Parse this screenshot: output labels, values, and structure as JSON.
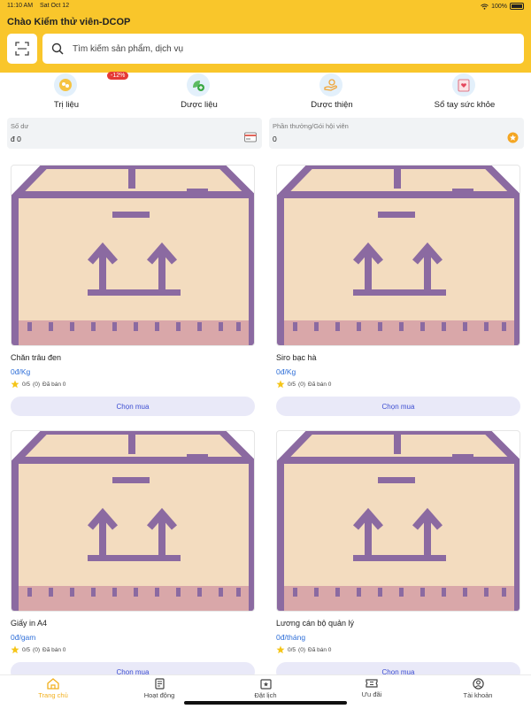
{
  "status": {
    "time": "11:10 AM",
    "date": "Sat Oct 12",
    "battery": "100%"
  },
  "header": {
    "title": "Chào Kiểm thử viên-DCOP"
  },
  "search": {
    "placeholder": "Tìm kiếm sản phẩm, dịch vụ"
  },
  "categories": [
    {
      "label": "Trị liệu",
      "badge": "-12%",
      "icon": "therapy-icon"
    },
    {
      "label": "Dược liệu",
      "icon": "herb-icon"
    },
    {
      "label": "Dược thiện",
      "icon": "charity-hand-icon"
    },
    {
      "label": "Sổ tay sức khỏe",
      "icon": "health-notebook-icon"
    }
  ],
  "balance": {
    "label": "Số dư",
    "value": "đ 0",
    "icon": "wallet-icon"
  },
  "rewards": {
    "label": "Phần thưởng/Gói hội viên",
    "value": "0",
    "icon": "coin-icon"
  },
  "products": [
    {
      "name": "Chăn trâu đen",
      "price": "0đ/Kg",
      "rating": "0/5",
      "reviews": "(0)",
      "sold": "Đã bán 0",
      "buy_label": "Chọn mua"
    },
    {
      "name": "Siro bạc hà",
      "price": "0đ/Kg",
      "rating": "0/5",
      "reviews": "(0)",
      "sold": "Đã bán 0",
      "buy_label": "Chọn mua"
    },
    {
      "name": "Giấy in A4",
      "price": "0đ/gam",
      "rating": "0/5",
      "reviews": "(0)",
      "sold": "Đã bán 0",
      "buy_label": "Chọn mua"
    },
    {
      "name": "Lương cán bộ quản lý",
      "price": "0đ/tháng",
      "rating": "0/5",
      "reviews": "(0)",
      "sold": "Đã bán 0",
      "buy_label": "Chọn mua"
    }
  ],
  "tabs": [
    {
      "label": "Trang chủ",
      "icon": "home-icon",
      "active": true
    },
    {
      "label": "Hoạt động",
      "icon": "activity-icon"
    },
    {
      "label": "Đặt lịch",
      "icon": "calendar-icon"
    },
    {
      "label": "Ưu đãi",
      "icon": "ticket-icon"
    },
    {
      "label": "Tài khoản",
      "icon": "account-icon"
    }
  ],
  "colors": {
    "header": "#f9c62b",
    "accent": "#f2b01e",
    "link": "#2f6fd8",
    "buy_bg": "#e9e9f8"
  }
}
